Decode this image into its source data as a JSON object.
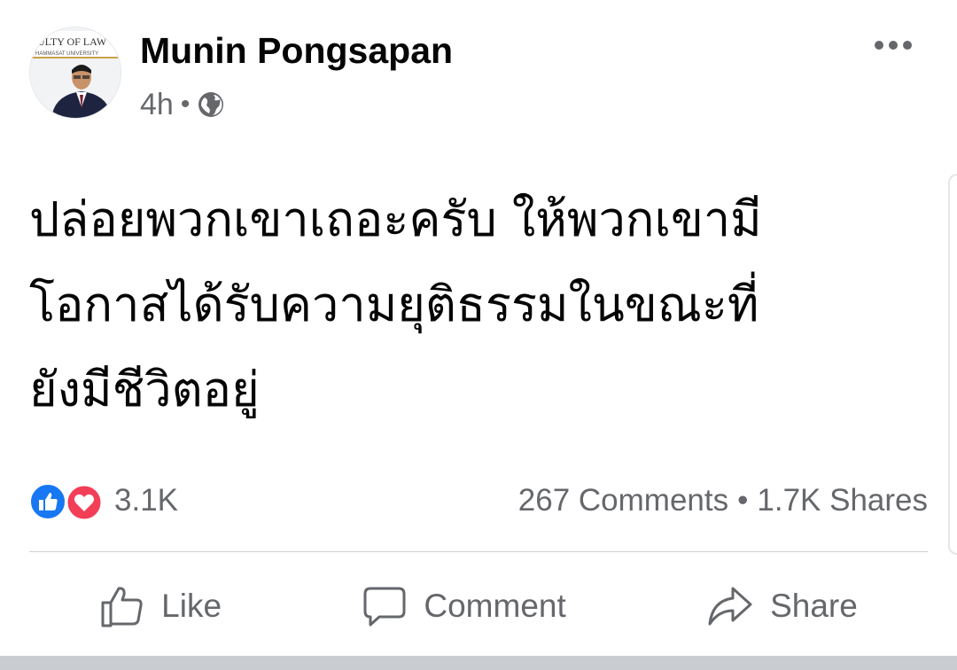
{
  "post": {
    "author_name": "Munin Pongsapan",
    "timestamp": "4h",
    "separator": "•",
    "privacy_icon": "globe-icon",
    "more_icon": "more-horizontal-icon",
    "avatar_banner_text_1": "ULTY OF LAW",
    "avatar_banner_text_2": "HAMMASAT UNIVERSITY",
    "text_lines": [
      "ปล่อยพวกเขาเถอะครับ ให้พวกเขามี",
      "โอกาสได้รับความยุติธรรมในขณะที่",
      "ยังมีชีวิตอยู่"
    ]
  },
  "stats": {
    "reactions_count": "3.1K",
    "comments": "267 Comments",
    "dot": "•",
    "shares": "1.7K Shares",
    "colors": {
      "like_blue": "#1877f2",
      "love_red": "#f33e58"
    }
  },
  "actions": {
    "like_label": "Like",
    "comment_label": "Comment",
    "share_label": "Share"
  }
}
